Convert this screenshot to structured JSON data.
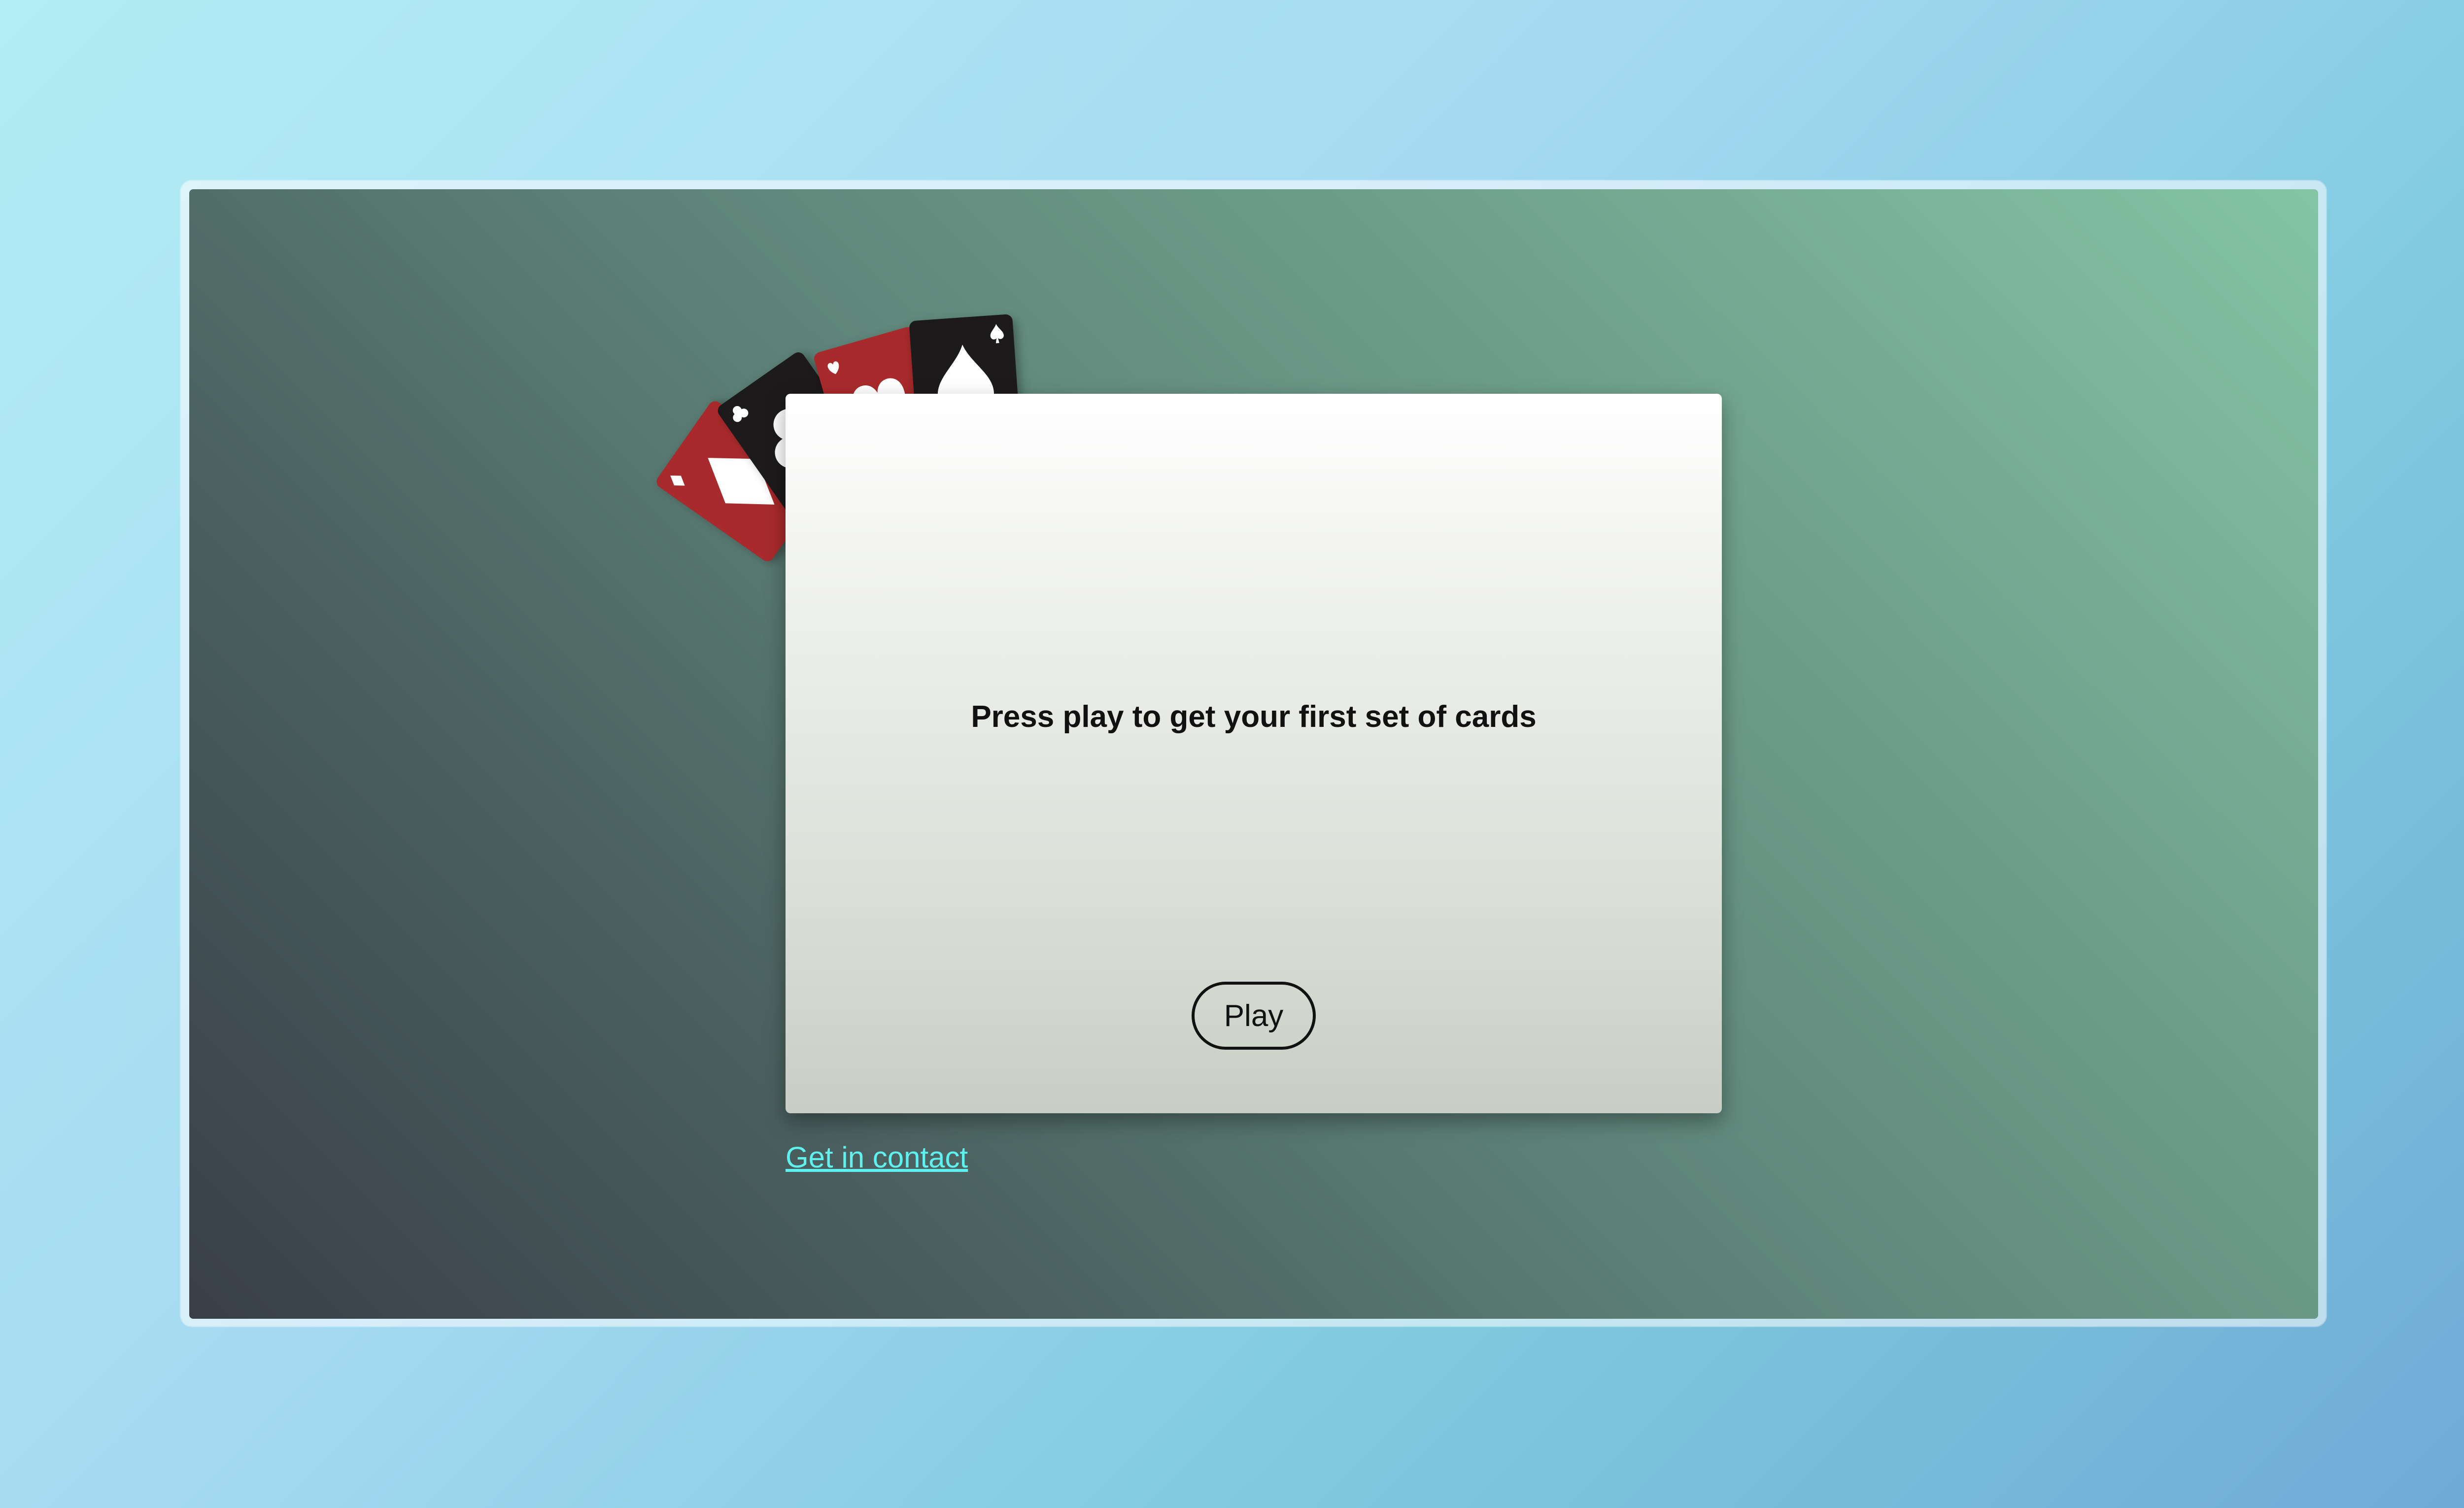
{
  "game": {
    "prompt": "Press play to get your first set of cards",
    "play_label": "Play"
  },
  "footer": {
    "contact_label": "Get in contact"
  },
  "cards": [
    {
      "suit": "diamond-icon",
      "color": "#a82a2c"
    },
    {
      "suit": "club-icon",
      "color": "#1c1a1b"
    },
    {
      "suit": "heart-icon",
      "color": "#a82a2c"
    },
    {
      "suit": "spade-icon",
      "color": "#1c1a1b"
    }
  ],
  "colors": {
    "card_red": "#a82a2c",
    "card_black": "#1c1a1b",
    "link": "#5ff0f0"
  }
}
